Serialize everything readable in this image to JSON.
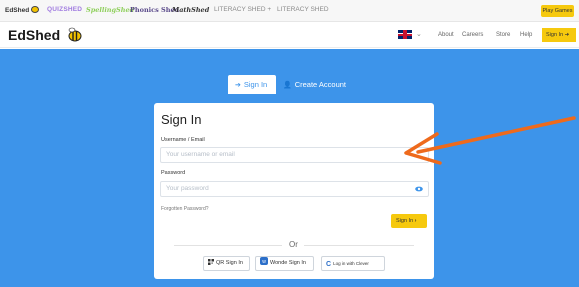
{
  "brands": {
    "edshed": "EdShed",
    "quizshed": "QUIZSHED",
    "spellingshed": "SpellingShed",
    "phonicsshed": "Phonics Shed",
    "mathshed": "MathShed",
    "literacy_menu": "LITERACY SHED +",
    "literacy": "LITERACY SHED"
  },
  "play_games": "Play Games",
  "header": {
    "logo": "EdShed",
    "nav": {
      "about": "About",
      "careers": "Careers",
      "store": "Store",
      "help": "Help",
      "sign_in": "Sign In"
    },
    "language_flag": "uk-flag-icon"
  },
  "tabs": {
    "sign_in": "Sign In",
    "create_account": "Create Account"
  },
  "form": {
    "title": "Sign In",
    "username_label": "Username / Email",
    "username_placeholder": "Your username or email",
    "password_label": "Password",
    "password_placeholder": "Your password",
    "forgot": "Forgotten Password?",
    "submit": "Sign In",
    "or": "Or",
    "qr": "QR Sign In",
    "wonde": "Wonde Sign In",
    "clever": "Log in with Clever"
  },
  "colors": {
    "primary_blue": "#3d94ea",
    "accent_yellow": "#f6c90e",
    "annotation_arrow": "#ee6a1c"
  }
}
